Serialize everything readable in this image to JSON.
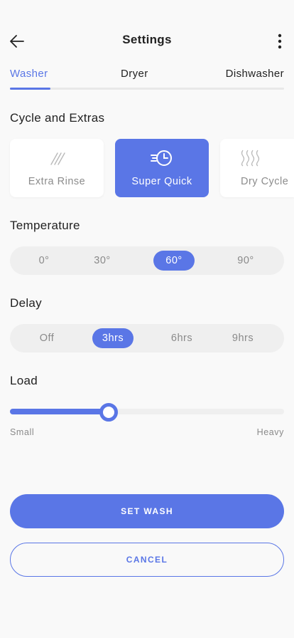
{
  "header": {
    "title": "Settings",
    "back_icon": "arrow-left-icon",
    "more_icon": "more-vertical-icon"
  },
  "tabs": [
    {
      "label": "Washer",
      "active": true
    },
    {
      "label": "Dryer",
      "active": false
    },
    {
      "label": "Dishwasher",
      "active": false
    }
  ],
  "cycle": {
    "title": "Cycle and Extras",
    "items": [
      {
        "label": "Extra Rinse",
        "icon": "rinse-icon",
        "active": false
      },
      {
        "label": "Super Quick",
        "icon": "quick-timer-icon",
        "active": true
      },
      {
        "label": "Dry Cycle",
        "icon": "heat-waves-icon",
        "active": false
      }
    ]
  },
  "temperature": {
    "title": "Temperature",
    "options": [
      "0°",
      "30°",
      "60°",
      "90°"
    ],
    "selected": "60°"
  },
  "delay": {
    "title": "Delay",
    "options": [
      "Off",
      "3hrs",
      "6hrs",
      "9hrs"
    ],
    "selected": "3hrs"
  },
  "load": {
    "title": "Load",
    "min_label": "Small",
    "max_label": "Heavy",
    "value_fraction": 0.36
  },
  "actions": {
    "primary": "SET WASH",
    "secondary": "CANCEL"
  },
  "colors": {
    "accent": "#5a76e6",
    "background": "#f9f9f9",
    "muted_text": "#8a8a8a"
  }
}
